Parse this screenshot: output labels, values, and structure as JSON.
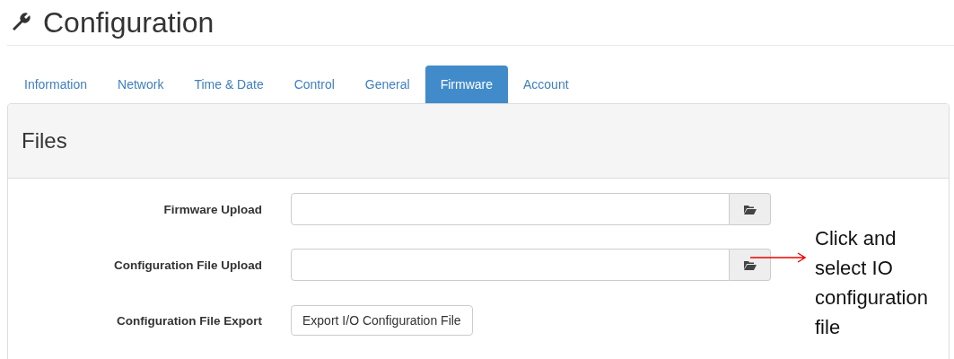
{
  "title": "Configuration",
  "tabs": [
    {
      "label": "Information",
      "selected": false
    },
    {
      "label": "Network",
      "selected": false
    },
    {
      "label": "Time & Date",
      "selected": false
    },
    {
      "label": "Control",
      "selected": false
    },
    {
      "label": "General",
      "selected": false
    },
    {
      "label": "Firmware",
      "selected": true
    },
    {
      "label": "Account",
      "selected": false
    }
  ],
  "panel": {
    "heading": "Files",
    "rows": [
      {
        "kind": "file",
        "label": "Firmware Upload"
      },
      {
        "kind": "file",
        "label": "Configuration File Upload"
      },
      {
        "kind": "button",
        "label": "Configuration File Export",
        "button": "Export I/O Configuration File"
      }
    ]
  },
  "annotation": {
    "text": "Click and select IO configuration file"
  }
}
